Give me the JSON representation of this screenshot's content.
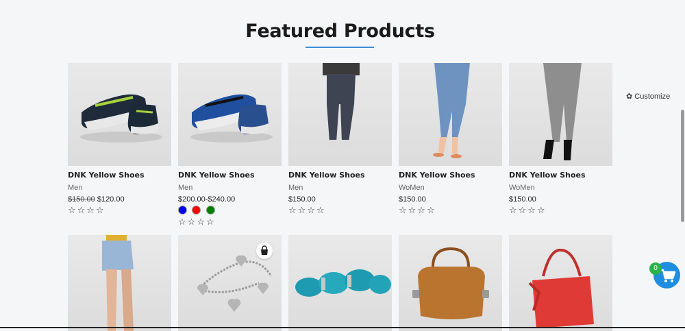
{
  "header": {
    "title": "Featured Products"
  },
  "customize": {
    "icon": "gear-icon",
    "label": "Customize"
  },
  "products_row1": [
    {
      "name": "DNK Yellow Shoes",
      "category": "Men",
      "old_price": "$150.00",
      "price": "$120.00",
      "image": "sneaker-navy",
      "rating": "☆☆☆☆"
    },
    {
      "name": "DNK Yellow Shoes",
      "category": "Men",
      "price": "$200.00-$240.00",
      "image": "sneaker-blue",
      "swatches": [
        "#0000ff",
        "#ff0000",
        "#008000"
      ],
      "rating": "☆☆☆☆"
    },
    {
      "name": "DNK Yellow Shoes",
      "category": "Men",
      "price": "$150.00",
      "image": "jeans-man",
      "rating": "☆☆☆☆"
    },
    {
      "name": "DNK Yellow Shoes",
      "category": "WoMen",
      "price": "$150.00",
      "image": "jeans-woman-blue",
      "rating": "☆☆☆☆"
    },
    {
      "name": "DNK Yellow Shoes",
      "category": "WoMen",
      "price": "$150.00",
      "image": "jeans-woman-gray",
      "rating": "☆☆☆☆"
    }
  ],
  "products_row2": [
    {
      "image": "denim-shorts"
    },
    {
      "image": "heart-charm-bracelet",
      "quick_add": "bag-icon"
    },
    {
      "image": "turquoise-bracelet"
    },
    {
      "image": "brown-handbag"
    },
    {
      "image": "red-handbag"
    }
  ],
  "cart": {
    "count": "0",
    "icon": "cart-icon"
  },
  "colors": {
    "accent": "#3b8fd6",
    "cart": "#1f8ee0",
    "badge": "#2bb34a"
  }
}
